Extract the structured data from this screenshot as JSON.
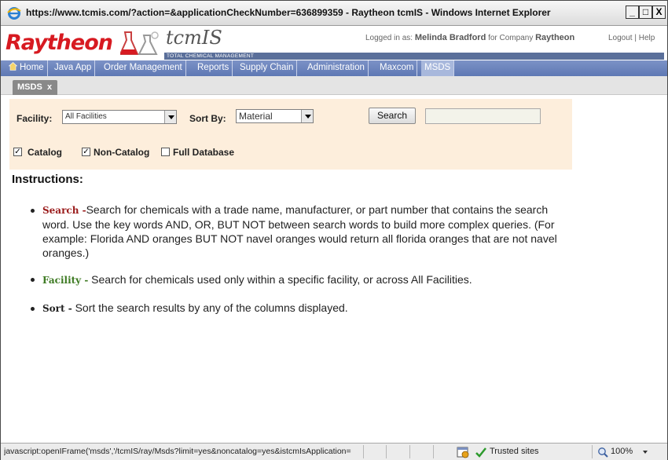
{
  "window": {
    "title": "https://www.tcmis.com/?action=&applicationCheckNumber=636899359 - Raytheon tcmIS - Windows Internet Explorer"
  },
  "header": {
    "brand": "Raytheon",
    "product": "tcmIS",
    "product_sub": "TOTAL CHEMICAL MANAGEMENT",
    "logged_in_prefix": "Logged in as:",
    "user_name": "Melinda Bradford",
    "company_prefix": "for Company",
    "company_name": "Raytheon",
    "logout": "Logout",
    "separator": "|",
    "help": "Help"
  },
  "nav": {
    "items": [
      "Home",
      "Java App",
      "Order Management",
      "Reports",
      "Supply Chain",
      "Administration",
      "Maxcom",
      "MSDS"
    ],
    "active": "MSDS"
  },
  "tabs": [
    {
      "label": "MSDS",
      "close": "x"
    }
  ],
  "search_panel": {
    "facility_label": "Facility:",
    "facility_value": "All Facilities",
    "sortby_label": "Sort By:",
    "sortby_value": "Material",
    "search_button": "Search",
    "search_text": "",
    "catalog_label": "Catalog",
    "catalog_checked": true,
    "noncatalog_label": "Non-Catalog",
    "noncatalog_checked": true,
    "fulldb_label": "Full Database",
    "fulldb_checked": false
  },
  "instructions": {
    "title": "Instructions:",
    "items": [
      {
        "keyword": "Search -",
        "text": "Search for chemicals with a trade name, manufacturer, or part number that contains the search word. Use the key words AND, OR, BUT NOT between search words to build more complex queries. (For example: Florida AND oranges BUT NOT navel oranges would return all florida oranges that are not navel oranges.)"
      },
      {
        "keyword": "Facility -",
        "text": " Search for chemicals used only within a specific facility, or across All Facilities."
      },
      {
        "keyword": "Sort -",
        "text": " Sort the search results by any of the columns displayed."
      }
    ]
  },
  "statusbar": {
    "url": "javascript:openIFrame('msds','/tcmIS/ray/Msds?limit=yes&noncatalog=yes&istcmIsApplication=",
    "zone": "Trusted sites",
    "zoom": "100%"
  },
  "colors": {
    "brand_red": "#d71a21",
    "nav_blue": "#6a82bc",
    "panel_bg": "#fdeedc",
    "keyword_red": "#9a1b1b",
    "keyword_green": "#3d7a22"
  }
}
